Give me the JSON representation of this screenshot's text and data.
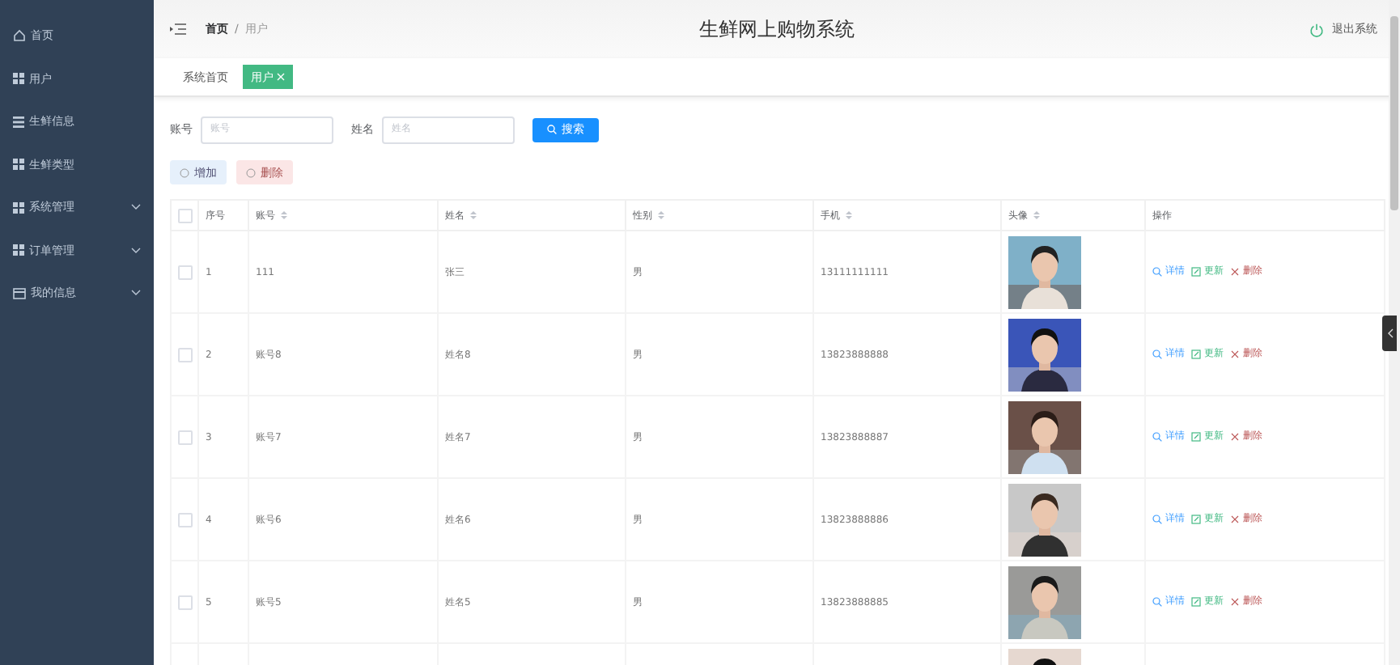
{
  "sidebar": {
    "items": [
      {
        "label": "首页",
        "expandable": false
      },
      {
        "label": "用户",
        "expandable": false
      },
      {
        "label": "生鲜信息",
        "expandable": false
      },
      {
        "label": "生鲜类型",
        "expandable": false
      },
      {
        "label": "系统管理",
        "expandable": true
      },
      {
        "label": "订单管理",
        "expandable": true
      },
      {
        "label": "我的信息",
        "expandable": true
      }
    ]
  },
  "header": {
    "breadcrumb": [
      "首页",
      "用户"
    ],
    "breadcrumb_separator": "/",
    "title": "生鲜网上购物系统",
    "logout": "退出系统"
  },
  "tags": [
    {
      "label": "系统首页",
      "selected": false,
      "closable": false
    },
    {
      "label": "用户",
      "selected": true,
      "closable": true
    }
  ],
  "search": {
    "fields": [
      {
        "label": "账号",
        "placeholder": "账号"
      },
      {
        "label": "姓名",
        "placeholder": "姓名"
      }
    ],
    "button": "搜索"
  },
  "actions": [
    {
      "label": "增加",
      "kind": "add"
    },
    {
      "label": "删除",
      "kind": "delete"
    }
  ],
  "table": {
    "all_checked": false,
    "columns": [
      {
        "label": "序号",
        "sortable": false
      },
      {
        "label": "账号",
        "sortable": true
      },
      {
        "label": "姓名",
        "sortable": true
      },
      {
        "label": "性别",
        "sortable": true
      },
      {
        "label": "手机",
        "sortable": true
      },
      {
        "label": "头像",
        "sortable": true
      },
      {
        "label": "操作",
        "sortable": false
      }
    ],
    "rows": [
      {
        "index": "1",
        "account": "111",
        "name": "张三",
        "gender": "男",
        "phone": "13111111111",
        "checked": false,
        "actions": [
          {
            "label": "详情",
            "kind": "detail"
          },
          {
            "label": "更新",
            "kind": "update"
          },
          {
            "label": "删除",
            "kind": "delete"
          }
        ]
      },
      {
        "index": "2",
        "account": "账号8",
        "name": "姓名8",
        "gender": "男",
        "phone": "13823888888",
        "checked": false,
        "actions": [
          {
            "label": "详情",
            "kind": "detail"
          },
          {
            "label": "更新",
            "kind": "update"
          },
          {
            "label": "删除",
            "kind": "delete"
          }
        ]
      },
      {
        "index": "3",
        "account": "账号7",
        "name": "姓名7",
        "gender": "男",
        "phone": "13823888887",
        "checked": false,
        "actions": [
          {
            "label": "详情",
            "kind": "detail"
          },
          {
            "label": "更新",
            "kind": "update"
          },
          {
            "label": "删除",
            "kind": "delete"
          }
        ]
      },
      {
        "index": "4",
        "account": "账号6",
        "name": "姓名6",
        "gender": "男",
        "phone": "13823888886",
        "checked": false,
        "actions": [
          {
            "label": "详情",
            "kind": "detail"
          },
          {
            "label": "更新",
            "kind": "update"
          },
          {
            "label": "删除",
            "kind": "delete"
          }
        ]
      },
      {
        "index": "5",
        "account": "账号5",
        "name": "姓名5",
        "gender": "男",
        "phone": "13823888885",
        "checked": false,
        "actions": [
          {
            "label": "详情",
            "kind": "detail"
          },
          {
            "label": "更新",
            "kind": "update"
          },
          {
            "label": "删除",
            "kind": "delete"
          }
        ]
      }
    ]
  }
}
